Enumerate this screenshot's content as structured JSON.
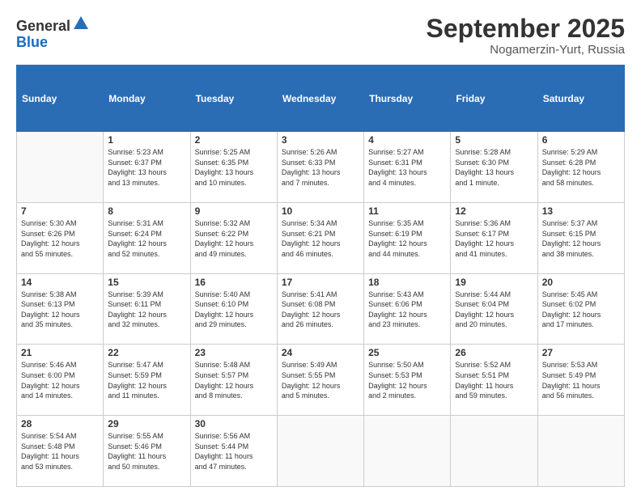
{
  "header": {
    "logo_line1": "General",
    "logo_line2": "Blue",
    "month": "September 2025",
    "location": "Nogamerzin-Yurt, Russia"
  },
  "weekdays": [
    "Sunday",
    "Monday",
    "Tuesday",
    "Wednesday",
    "Thursday",
    "Friday",
    "Saturday"
  ],
  "weeks": [
    [
      {
        "day": "",
        "info": ""
      },
      {
        "day": "1",
        "info": "Sunrise: 5:23 AM\nSunset: 6:37 PM\nDaylight: 13 hours\nand 13 minutes."
      },
      {
        "day": "2",
        "info": "Sunrise: 5:25 AM\nSunset: 6:35 PM\nDaylight: 13 hours\nand 10 minutes."
      },
      {
        "day": "3",
        "info": "Sunrise: 5:26 AM\nSunset: 6:33 PM\nDaylight: 13 hours\nand 7 minutes."
      },
      {
        "day": "4",
        "info": "Sunrise: 5:27 AM\nSunset: 6:31 PM\nDaylight: 13 hours\nand 4 minutes."
      },
      {
        "day": "5",
        "info": "Sunrise: 5:28 AM\nSunset: 6:30 PM\nDaylight: 13 hours\nand 1 minute."
      },
      {
        "day": "6",
        "info": "Sunrise: 5:29 AM\nSunset: 6:28 PM\nDaylight: 12 hours\nand 58 minutes."
      }
    ],
    [
      {
        "day": "7",
        "info": "Sunrise: 5:30 AM\nSunset: 6:26 PM\nDaylight: 12 hours\nand 55 minutes."
      },
      {
        "day": "8",
        "info": "Sunrise: 5:31 AM\nSunset: 6:24 PM\nDaylight: 12 hours\nand 52 minutes."
      },
      {
        "day": "9",
        "info": "Sunrise: 5:32 AM\nSunset: 6:22 PM\nDaylight: 12 hours\nand 49 minutes."
      },
      {
        "day": "10",
        "info": "Sunrise: 5:34 AM\nSunset: 6:21 PM\nDaylight: 12 hours\nand 46 minutes."
      },
      {
        "day": "11",
        "info": "Sunrise: 5:35 AM\nSunset: 6:19 PM\nDaylight: 12 hours\nand 44 minutes."
      },
      {
        "day": "12",
        "info": "Sunrise: 5:36 AM\nSunset: 6:17 PM\nDaylight: 12 hours\nand 41 minutes."
      },
      {
        "day": "13",
        "info": "Sunrise: 5:37 AM\nSunset: 6:15 PM\nDaylight: 12 hours\nand 38 minutes."
      }
    ],
    [
      {
        "day": "14",
        "info": "Sunrise: 5:38 AM\nSunset: 6:13 PM\nDaylight: 12 hours\nand 35 minutes."
      },
      {
        "day": "15",
        "info": "Sunrise: 5:39 AM\nSunset: 6:11 PM\nDaylight: 12 hours\nand 32 minutes."
      },
      {
        "day": "16",
        "info": "Sunrise: 5:40 AM\nSunset: 6:10 PM\nDaylight: 12 hours\nand 29 minutes."
      },
      {
        "day": "17",
        "info": "Sunrise: 5:41 AM\nSunset: 6:08 PM\nDaylight: 12 hours\nand 26 minutes."
      },
      {
        "day": "18",
        "info": "Sunrise: 5:43 AM\nSunset: 6:06 PM\nDaylight: 12 hours\nand 23 minutes."
      },
      {
        "day": "19",
        "info": "Sunrise: 5:44 AM\nSunset: 6:04 PM\nDaylight: 12 hours\nand 20 minutes."
      },
      {
        "day": "20",
        "info": "Sunrise: 5:45 AM\nSunset: 6:02 PM\nDaylight: 12 hours\nand 17 minutes."
      }
    ],
    [
      {
        "day": "21",
        "info": "Sunrise: 5:46 AM\nSunset: 6:00 PM\nDaylight: 12 hours\nand 14 minutes."
      },
      {
        "day": "22",
        "info": "Sunrise: 5:47 AM\nSunset: 5:59 PM\nDaylight: 12 hours\nand 11 minutes."
      },
      {
        "day": "23",
        "info": "Sunrise: 5:48 AM\nSunset: 5:57 PM\nDaylight: 12 hours\nand 8 minutes."
      },
      {
        "day": "24",
        "info": "Sunrise: 5:49 AM\nSunset: 5:55 PM\nDaylight: 12 hours\nand 5 minutes."
      },
      {
        "day": "25",
        "info": "Sunrise: 5:50 AM\nSunset: 5:53 PM\nDaylight: 12 hours\nand 2 minutes."
      },
      {
        "day": "26",
        "info": "Sunrise: 5:52 AM\nSunset: 5:51 PM\nDaylight: 11 hours\nand 59 minutes."
      },
      {
        "day": "27",
        "info": "Sunrise: 5:53 AM\nSunset: 5:49 PM\nDaylight: 11 hours\nand 56 minutes."
      }
    ],
    [
      {
        "day": "28",
        "info": "Sunrise: 5:54 AM\nSunset: 5:48 PM\nDaylight: 11 hours\nand 53 minutes."
      },
      {
        "day": "29",
        "info": "Sunrise: 5:55 AM\nSunset: 5:46 PM\nDaylight: 11 hours\nand 50 minutes."
      },
      {
        "day": "30",
        "info": "Sunrise: 5:56 AM\nSunset: 5:44 PM\nDaylight: 11 hours\nand 47 minutes."
      },
      {
        "day": "",
        "info": ""
      },
      {
        "day": "",
        "info": ""
      },
      {
        "day": "",
        "info": ""
      },
      {
        "day": "",
        "info": ""
      }
    ]
  ]
}
